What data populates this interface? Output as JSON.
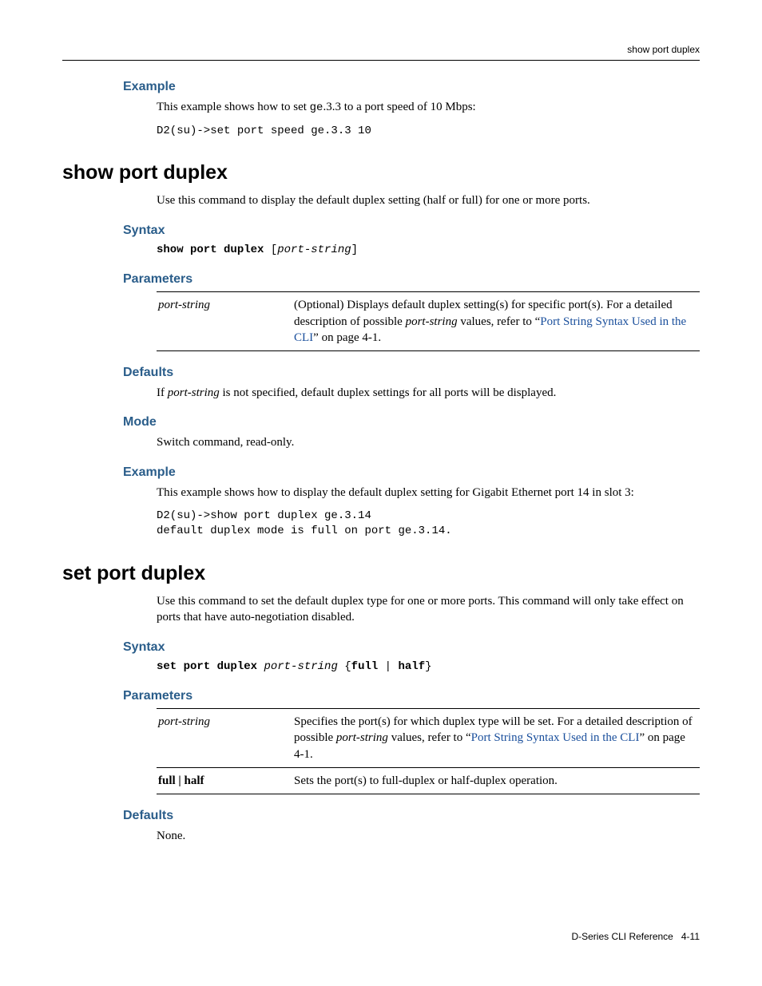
{
  "running_head": "show port duplex",
  "prev_example": {
    "heading": "Example",
    "intro_pre": "This example shows how to set ",
    "intro_code": "ge",
    "intro_post": ".3.3 to a port speed of 10 Mbps:",
    "code": "D2(su)->set port speed ge.3.3 10"
  },
  "show": {
    "title": "show port duplex",
    "description": "Use this command to display the default duplex setting (half or full) for one or more ports.",
    "syntax_heading": "Syntax",
    "syntax_cmd": "show port duplex",
    "syntax_open": " [",
    "syntax_arg": "port-string",
    "syntax_close": "]",
    "params_heading": "Parameters",
    "param_name": "port-string",
    "param_desc_pre": "(Optional) Displays default duplex setting(s) for specific port(s). For a detailed description of possible ",
    "param_desc_ital": "port-string",
    "param_desc_mid": " values, refer to “",
    "param_desc_link": "Port String Syntax Used in the CLI",
    "param_desc_post": "” on page 4-1.",
    "defaults_heading": "Defaults",
    "defaults_text_pre": "If ",
    "defaults_text_ital": "port-string",
    "defaults_text_post": " is not specified, default duplex settings for all ports will be displayed.",
    "mode_heading": "Mode",
    "mode_text": "Switch command, read-only.",
    "example_heading": "Example",
    "example_intro": "This example shows how to display the default duplex setting for Gigabit Ethernet port 14 in slot 3:",
    "example_code": "D2(su)->show port duplex ge.3.14\ndefault duplex mode is full on port ge.3.14."
  },
  "set": {
    "title": "set port duplex",
    "description": "Use this command to set the default duplex type for one or more ports. This command will only take effect on ports that have auto-negotiation disabled.",
    "syntax_heading": "Syntax",
    "syntax_cmd": "set port duplex",
    "syntax_space": " ",
    "syntax_arg": "port-string",
    "syntax_brace_open": " {",
    "syntax_full": "full",
    "syntax_pipe": " | ",
    "syntax_half": "half",
    "syntax_brace_close": "}",
    "params_heading": "Parameters",
    "p1_name": "port-string",
    "p1_desc_pre": "Specifies the port(s) for which duplex type will be set. For a detailed description of possible ",
    "p1_desc_ital": "port-string",
    "p1_desc_mid": " values, refer to “",
    "p1_desc_link": "Port String Syntax Used in the CLI",
    "p1_desc_post": "” on page 4-1.",
    "p2_name": "full | half",
    "p2_desc": "Sets the port(s) to full-duplex or half-duplex operation.",
    "defaults_heading": "Defaults",
    "defaults_text": "None."
  },
  "footer": {
    "doc": "D-Series CLI Reference",
    "page": "4-11"
  }
}
